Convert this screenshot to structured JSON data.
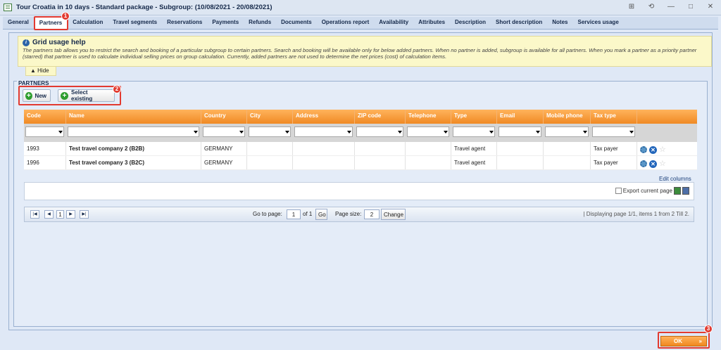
{
  "window": {
    "title": "Tour Croatia in 10 days - Standard package - Subgroup: (10/08/2021 - 20/08/2021)",
    "controls": [
      "⊞",
      "⟲",
      "—",
      "□",
      "✕"
    ]
  },
  "tabs": [
    "General",
    "Partners",
    "Calculation",
    "Travel segments",
    "Reservations",
    "Payments",
    "Refunds",
    "Documents",
    "Operations report",
    "Availability",
    "Attributes",
    "Description",
    "Short description",
    "Notes",
    "Services usage"
  ],
  "active_tab": "Partners",
  "markers": [
    "1",
    "2",
    "3"
  ],
  "help": {
    "title": "Grid usage help",
    "text": "The partners tab allows you to restrict the search and booking of a particular subgroup to certain partners. Search and booking will be available only for below added partners. When no partner is added, subgroup is available for all partners. When you mark a partner as a priority partner (starred) that partner is used to calculate individual selling prices on group calculation. Currently, added partners are not used to determine the net prices (cost) of calculation items.",
    "hide_label": "▲ Hide"
  },
  "partners": {
    "section_title": "PARTNERS",
    "new_label": "New",
    "select_existing_label": "Select existing",
    "columns": [
      "Code",
      "Name",
      "Country",
      "City",
      "Address",
      "ZIP code",
      "Telephone",
      "Type",
      "Email",
      "Mobile phone",
      "Tax type",
      ""
    ],
    "rows": [
      {
        "code": "1993",
        "name": "Test travel company 2 (B2B)",
        "country": "GERMANY",
        "city": "",
        "address": "",
        "zip": "",
        "telephone": "",
        "type": "Travel agent",
        "email": "",
        "mobile": "",
        "tax": "Tax payer"
      },
      {
        "code": "1996",
        "name": "Test travel company 3 (B2C)",
        "country": "GERMANY",
        "city": "",
        "address": "",
        "zip": "",
        "telephone": "",
        "type": "Travel agent",
        "email": "",
        "mobile": "",
        "tax": "Tax payer"
      }
    ],
    "edit_columns": "Edit columns",
    "export_label": "Export current page"
  },
  "pager": {
    "current_page": "1",
    "go_to_label": "Go to page:",
    "go_to_value": "1",
    "of_label": "of 1",
    "go_button": "Go",
    "page_size_label": "Page size:",
    "page_size_value": "2",
    "change_button": "Change",
    "status": "| Displaying page  1/1,  items  1  from  2  Till  2."
  },
  "footer": {
    "ok_label": "OK"
  }
}
